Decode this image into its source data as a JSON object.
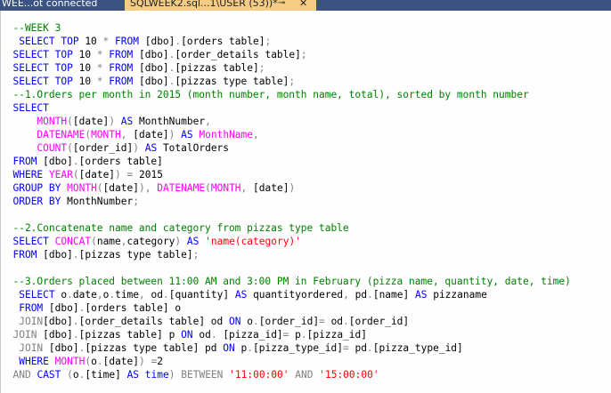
{
  "tabs": {
    "inactive_label": "WEE...ot connected",
    "active_label": "SQLWEEK2.sql...1\\USER (53))*",
    "pin_glyph": "⊸",
    "close_glyph": "✕"
  },
  "code_lines": [
    [
      {
        "c": "cm",
        "t": "  --WEEK 3"
      }
    ],
    [
      {
        "c": "",
        "t": "   "
      },
      {
        "c": "kw",
        "t": "SELECT TOP"
      },
      {
        "c": "",
        "t": " 10 "
      },
      {
        "c": "gr",
        "t": "*"
      },
      {
        "c": "",
        "t": " "
      },
      {
        "c": "kw",
        "t": "FROM"
      },
      {
        "c": "",
        "t": " [dbo]"
      },
      {
        "c": "gr",
        "t": "."
      },
      {
        "c": "",
        "t": "[orders table]"
      },
      {
        "c": "gr",
        "t": ";"
      }
    ],
    [
      {
        "c": "",
        "t": "  "
      },
      {
        "c": "kw",
        "t": "SELECT TOP"
      },
      {
        "c": "",
        "t": " 10 "
      },
      {
        "c": "gr",
        "t": "*"
      },
      {
        "c": "",
        "t": " "
      },
      {
        "c": "kw",
        "t": "FROM"
      },
      {
        "c": "",
        "t": " [dbo]"
      },
      {
        "c": "gr",
        "t": "."
      },
      {
        "c": "",
        "t": "[order_details table]"
      },
      {
        "c": "gr",
        "t": ";"
      }
    ],
    [
      {
        "c": "",
        "t": "  "
      },
      {
        "c": "kw",
        "t": "SELECT TOP"
      },
      {
        "c": "",
        "t": " 10 "
      },
      {
        "c": "gr",
        "t": "*"
      },
      {
        "c": "",
        "t": " "
      },
      {
        "c": "kw",
        "t": "FROM"
      },
      {
        "c": "",
        "t": " [dbo]"
      },
      {
        "c": "gr",
        "t": "."
      },
      {
        "c": "",
        "t": "[pizzas table]"
      },
      {
        "c": "gr",
        "t": ";"
      }
    ],
    [
      {
        "c": "",
        "t": "  "
      },
      {
        "c": "kw",
        "t": "SELECT TOP"
      },
      {
        "c": "",
        "t": " 10 "
      },
      {
        "c": "gr",
        "t": "*"
      },
      {
        "c": "",
        "t": " "
      },
      {
        "c": "kw",
        "t": "FROM"
      },
      {
        "c": "",
        "t": " [dbo]"
      },
      {
        "c": "gr",
        "t": "."
      },
      {
        "c": "",
        "t": "[pizzas type table]"
      },
      {
        "c": "gr",
        "t": ";"
      }
    ],
    [
      {
        "c": "cm",
        "t": "  --1.Orders per month in 2015 (month number, month name, total), sorted by month number"
      }
    ],
    [
      {
        "c": "",
        "t": "  "
      },
      {
        "c": "kw",
        "t": "SELECT"
      }
    ],
    [
      {
        "c": "",
        "t": "      "
      },
      {
        "c": "fn",
        "t": "MONTH"
      },
      {
        "c": "gr",
        "t": "("
      },
      {
        "c": "",
        "t": "[date]"
      },
      {
        "c": "gr",
        "t": ")"
      },
      {
        "c": "",
        "t": " "
      },
      {
        "c": "kw",
        "t": "AS"
      },
      {
        "c": "",
        "t": " MonthNumber"
      },
      {
        "c": "gr",
        "t": ","
      }
    ],
    [
      {
        "c": "",
        "t": "      "
      },
      {
        "c": "fn",
        "t": "DATENAME"
      },
      {
        "c": "gr",
        "t": "("
      },
      {
        "c": "fn",
        "t": "MONTH"
      },
      {
        "c": "gr",
        "t": ","
      },
      {
        "c": "",
        "t": " [date]"
      },
      {
        "c": "gr",
        "t": ")"
      },
      {
        "c": "",
        "t": " "
      },
      {
        "c": "kw",
        "t": "AS"
      },
      {
        "c": "",
        "t": " "
      },
      {
        "c": "fn",
        "t": "MonthName"
      },
      {
        "c": "gr",
        "t": ","
      }
    ],
    [
      {
        "c": "",
        "t": "      "
      },
      {
        "c": "fn",
        "t": "COUNT"
      },
      {
        "c": "gr",
        "t": "("
      },
      {
        "c": "",
        "t": "[order_id]"
      },
      {
        "c": "gr",
        "t": ")"
      },
      {
        "c": "",
        "t": " "
      },
      {
        "c": "kw",
        "t": "AS"
      },
      {
        "c": "",
        "t": " TotalOrders"
      }
    ],
    [
      {
        "c": "",
        "t": "  "
      },
      {
        "c": "kw",
        "t": "FROM"
      },
      {
        "c": "",
        "t": " [dbo]"
      },
      {
        "c": "gr",
        "t": "."
      },
      {
        "c": "",
        "t": "[orders table]"
      }
    ],
    [
      {
        "c": "",
        "t": "  "
      },
      {
        "c": "kw",
        "t": "WHERE"
      },
      {
        "c": "",
        "t": " "
      },
      {
        "c": "fn",
        "t": "YEAR"
      },
      {
        "c": "gr",
        "t": "("
      },
      {
        "c": "",
        "t": "[date]"
      },
      {
        "c": "gr",
        "t": ")"
      },
      {
        "c": "",
        "t": " "
      },
      {
        "c": "gr",
        "t": "="
      },
      {
        "c": "",
        "t": " 2015"
      }
    ],
    [
      {
        "c": "",
        "t": "  "
      },
      {
        "c": "kw",
        "t": "GROUP BY"
      },
      {
        "c": "",
        "t": " "
      },
      {
        "c": "fn",
        "t": "MONTH"
      },
      {
        "c": "gr",
        "t": "("
      },
      {
        "c": "",
        "t": "[date]"
      },
      {
        "c": "gr",
        "t": "),"
      },
      {
        "c": "",
        "t": " "
      },
      {
        "c": "fn",
        "t": "DATENAME"
      },
      {
        "c": "gr",
        "t": "("
      },
      {
        "c": "fn",
        "t": "MONTH"
      },
      {
        "c": "gr",
        "t": ","
      },
      {
        "c": "",
        "t": " [date]"
      },
      {
        "c": "gr",
        "t": ")"
      }
    ],
    [
      {
        "c": "",
        "t": "  "
      },
      {
        "c": "kw",
        "t": "ORDER BY"
      },
      {
        "c": "",
        "t": " MonthNumber"
      },
      {
        "c": "gr",
        "t": ";"
      }
    ],
    [
      {
        "c": "",
        "t": ""
      }
    ],
    [
      {
        "c": "cm",
        "t": "  --2.Concatenate name and category from pizzas type table"
      }
    ],
    [
      {
        "c": "",
        "t": "  "
      },
      {
        "c": "kw",
        "t": "SELECT"
      },
      {
        "c": "",
        "t": " "
      },
      {
        "c": "fn",
        "t": "CONCAT"
      },
      {
        "c": "gr",
        "t": "("
      },
      {
        "c": "",
        "t": "name"
      },
      {
        "c": "gr",
        "t": ","
      },
      {
        "c": "",
        "t": "category"
      },
      {
        "c": "gr",
        "t": ")"
      },
      {
        "c": "",
        "t": " "
      },
      {
        "c": "kw",
        "t": "AS"
      },
      {
        "c": "",
        "t": " "
      },
      {
        "c": "st",
        "t": "'name(category)'"
      }
    ],
    [
      {
        "c": "",
        "t": "  "
      },
      {
        "c": "kw",
        "t": "FROM"
      },
      {
        "c": "",
        "t": " [dbo]"
      },
      {
        "c": "gr",
        "t": "."
      },
      {
        "c": "",
        "t": "[pizzas type table]"
      },
      {
        "c": "gr",
        "t": ";"
      }
    ],
    [
      {
        "c": "",
        "t": ""
      }
    ],
    [
      {
        "c": "cm",
        "t": "  --3.Orders placed between 11:00 AM and 3:00 PM in February (pizza name, quantity, date, time)"
      }
    ],
    [
      {
        "c": "",
        "t": "   "
      },
      {
        "c": "kw",
        "t": "SELECT"
      },
      {
        "c": "",
        "t": " o"
      },
      {
        "c": "gr",
        "t": "."
      },
      {
        "c": "",
        "t": "date"
      },
      {
        "c": "gr",
        "t": ","
      },
      {
        "c": "",
        "t": "o"
      },
      {
        "c": "gr",
        "t": "."
      },
      {
        "c": "",
        "t": "time"
      },
      {
        "c": "gr",
        "t": ","
      },
      {
        "c": "",
        "t": " od"
      },
      {
        "c": "gr",
        "t": "."
      },
      {
        "c": "",
        "t": "[quantity] "
      },
      {
        "c": "kw",
        "t": "AS"
      },
      {
        "c": "",
        "t": " quantityordered"
      },
      {
        "c": "gr",
        "t": ","
      },
      {
        "c": "",
        "t": " pd"
      },
      {
        "c": "gr",
        "t": "."
      },
      {
        "c": "",
        "t": "[name] "
      },
      {
        "c": "kw",
        "t": "AS"
      },
      {
        "c": "",
        "t": " pizzaname"
      }
    ],
    [
      {
        "c": "",
        "t": "   "
      },
      {
        "c": "kw",
        "t": "FROM"
      },
      {
        "c": "",
        "t": " [dbo]"
      },
      {
        "c": "gr",
        "t": "."
      },
      {
        "c": "",
        "t": "[orders table] o"
      }
    ],
    [
      {
        "c": "",
        "t": "   "
      },
      {
        "c": "gr",
        "t": "JOIN"
      },
      {
        "c": "",
        "t": "[dbo]"
      },
      {
        "c": "gr",
        "t": "."
      },
      {
        "c": "",
        "t": "[order_details table] od "
      },
      {
        "c": "kw",
        "t": "ON"
      },
      {
        "c": "",
        "t": " o"
      },
      {
        "c": "gr",
        "t": "."
      },
      {
        "c": "",
        "t": "[order_id]"
      },
      {
        "c": "gr",
        "t": "="
      },
      {
        "c": "",
        "t": " od"
      },
      {
        "c": "gr",
        "t": "."
      },
      {
        "c": "",
        "t": "[order_id]"
      }
    ],
    [
      {
        "c": "",
        "t": "  "
      },
      {
        "c": "gr",
        "t": "JOIN"
      },
      {
        "c": "",
        "t": " [dbo]"
      },
      {
        "c": "gr",
        "t": "."
      },
      {
        "c": "",
        "t": "[pizzas table] p "
      },
      {
        "c": "kw",
        "t": "ON"
      },
      {
        "c": "",
        "t": " od"
      },
      {
        "c": "gr",
        "t": "."
      },
      {
        "c": "",
        "t": " [pizza_id]"
      },
      {
        "c": "gr",
        "t": "="
      },
      {
        "c": "",
        "t": " p"
      },
      {
        "c": "gr",
        "t": "."
      },
      {
        "c": "",
        "t": "[pizza_id]"
      }
    ],
    [
      {
        "c": "",
        "t": "   "
      },
      {
        "c": "gr",
        "t": "JOIN"
      },
      {
        "c": "",
        "t": " [dbo]"
      },
      {
        "c": "gr",
        "t": "."
      },
      {
        "c": "",
        "t": "[pizzas type table] pd "
      },
      {
        "c": "kw",
        "t": "ON"
      },
      {
        "c": "",
        "t": " p"
      },
      {
        "c": "gr",
        "t": "."
      },
      {
        "c": "",
        "t": "[pizza_type_id]"
      },
      {
        "c": "gr",
        "t": "="
      },
      {
        "c": "",
        "t": " pd"
      },
      {
        "c": "gr",
        "t": "."
      },
      {
        "c": "",
        "t": "[pizza_type_id]"
      }
    ],
    [
      {
        "c": "",
        "t": "   "
      },
      {
        "c": "kw",
        "t": "WHERE"
      },
      {
        "c": "",
        "t": " "
      },
      {
        "c": "fn",
        "t": "MONTH"
      },
      {
        "c": "gr",
        "t": "("
      },
      {
        "c": "",
        "t": "o"
      },
      {
        "c": "gr",
        "t": "."
      },
      {
        "c": "",
        "t": "[date]"
      },
      {
        "c": "gr",
        "t": ")"
      },
      {
        "c": "",
        "t": " "
      },
      {
        "c": "gr",
        "t": "="
      },
      {
        "c": "",
        "t": "2"
      }
    ],
    [
      {
        "c": "",
        "t": "  "
      },
      {
        "c": "gr",
        "t": "AND"
      },
      {
        "c": "",
        "t": " "
      },
      {
        "c": "kw",
        "t": "CAST"
      },
      {
        "c": "",
        "t": " "
      },
      {
        "c": "gr",
        "t": "("
      },
      {
        "c": "",
        "t": "o"
      },
      {
        "c": "gr",
        "t": "."
      },
      {
        "c": "",
        "t": "[time] "
      },
      {
        "c": "kw",
        "t": "AS"
      },
      {
        "c": "",
        "t": " "
      },
      {
        "c": "kw",
        "t": "time"
      },
      {
        "c": "gr",
        "t": ")"
      },
      {
        "c": "",
        "t": " "
      },
      {
        "c": "gr",
        "t": "BETWEEN"
      },
      {
        "c": "",
        "t": " "
      },
      {
        "c": "st",
        "t": "'11:00:00'"
      },
      {
        "c": "",
        "t": " "
      },
      {
        "c": "gr",
        "t": "AND"
      },
      {
        "c": "",
        "t": " "
      },
      {
        "c": "st",
        "t": "'15:00:00'"
      }
    ]
  ]
}
